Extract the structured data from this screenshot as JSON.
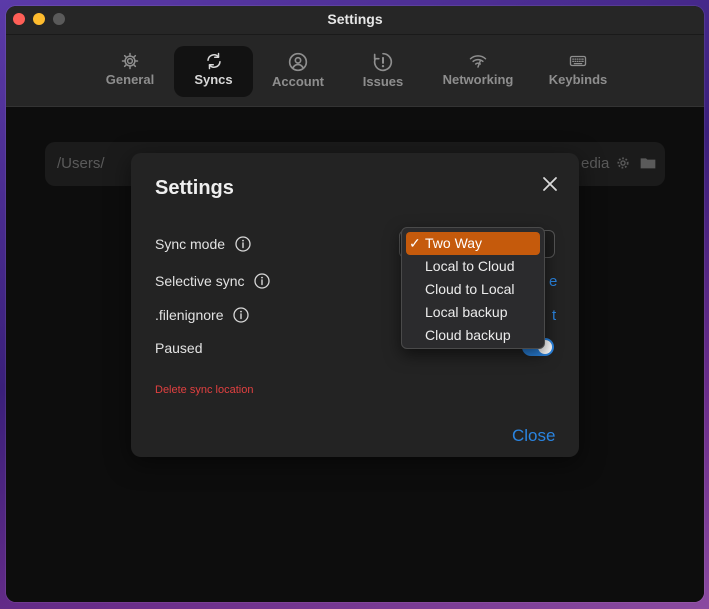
{
  "window": {
    "title": "Settings"
  },
  "tabs": [
    {
      "label": "General",
      "icon": "gear-icon",
      "active": false
    },
    {
      "label": "Syncs",
      "icon": "sync-icon",
      "active": true
    },
    {
      "label": "Account",
      "icon": "user-icon",
      "active": false
    },
    {
      "label": "Issues",
      "icon": "alert-icon",
      "active": false
    },
    {
      "label": "Networking",
      "icon": "wifi-icon",
      "active": false
    },
    {
      "label": "Keybinds",
      "icon": "keyboard-icon",
      "active": false
    }
  ],
  "sync_row": {
    "path_start": "/Users/",
    "path_end": "edia"
  },
  "modal": {
    "title": "Settings",
    "sync_mode_label": "Sync mode",
    "selective_sync_label": "Selective sync",
    "filenignore_label": ".filenignore",
    "paused_label": "Paused",
    "selective_sync_peek": "e",
    "filenignore_peek": "t",
    "paused": true,
    "delete_label": "Delete sync location",
    "close_label": "Close"
  },
  "sync_mode_dropdown": {
    "selected": "Two Way",
    "options": [
      "Two Way",
      "Local to Cloud",
      "Cloud to Local",
      "Local backup",
      "Cloud backup"
    ]
  },
  "colors": {
    "accent_blue": "#2a84e0",
    "selected_orange": "#c55a0c",
    "danger_red": "#e04040"
  }
}
